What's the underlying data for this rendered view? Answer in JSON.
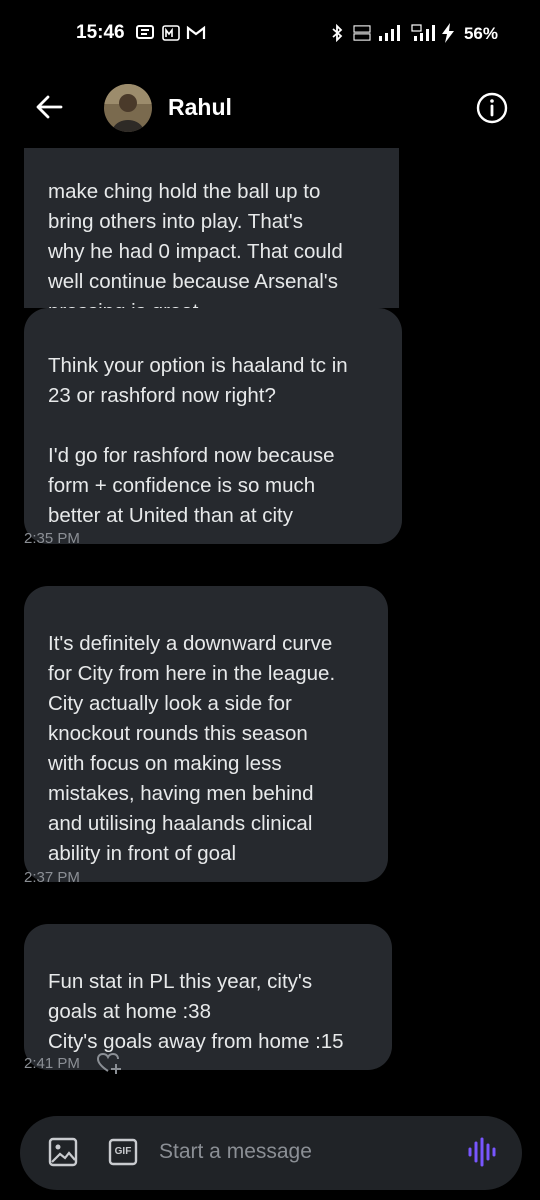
{
  "status": {
    "time": "15:46",
    "battery": "56%"
  },
  "header": {
    "name": "Rahul"
  },
  "messages": [
    {
      "text": "make ching hold the ball up to\nbring others into play. That's\nwhy he had 0 impact. That could\nwell continue because Arsenal's\npressing is great"
    },
    {
      "text": "Think your option is haaland tc in\n23 or rashford now right?\n\nI'd go for rashford now because\nform + confidence is so much\nbetter at United than at city"
    },
    {
      "text": "It's definitely a downward curve\nfor City from here in the league.\nCity actually look a side for\nknockout rounds this season\nwith focus on making less\nmistakes, having men behind\nand utilising haalands clinical\nability in front of goal"
    },
    {
      "text": "Fun stat in PL this year, city's\ngoals at home :38\nCity's goals away from home :15"
    }
  ],
  "timestamps": [
    "2:35 PM",
    "2:37 PM",
    "2:41 PM"
  ],
  "composer": {
    "placeholder": "Start a message",
    "gif_label": "GIF"
  },
  "colors": {
    "background": "#000000",
    "bubble": "#26292e",
    "accent_voice": "#7856ff"
  }
}
